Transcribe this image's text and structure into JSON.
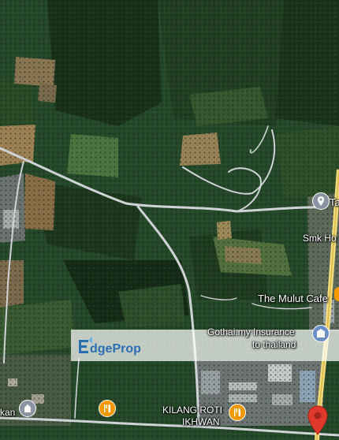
{
  "map": {
    "type": "satellite",
    "watermark": "EdgeProp",
    "colors": {
      "road": "#cfd2d6",
      "highway": "#f2dc7c",
      "pin_red": "#e0392b",
      "pin_orange": "#f29900",
      "pin_gray": "#8a94a3"
    }
  },
  "labels": {
    "ta": "Ta",
    "smk": "Smk Ho",
    "mulut": "The Mulut Cafe",
    "gothai_line1": "Gothai.my Insurance",
    "gothai_line2": "to thailand",
    "kilang_line1": "KILANG ROTI",
    "kilang_line2": "IKHWAN",
    "kan": "kan"
  }
}
